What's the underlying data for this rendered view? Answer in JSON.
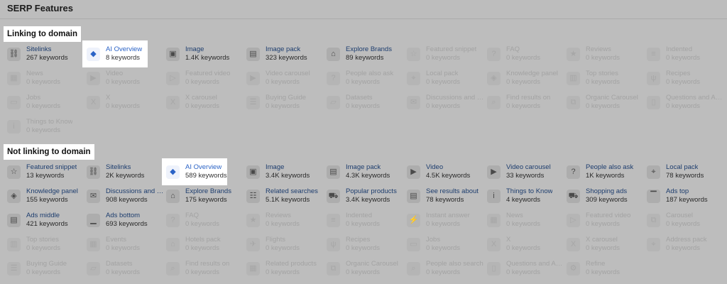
{
  "title": "SERP Features",
  "sections": {
    "linking": {
      "label": "Linking to domain",
      "rows": [
        [
          {
            "name": "Sitelinks",
            "count": "267 keywords",
            "icon": "link-icon",
            "state": "active"
          },
          {
            "name": "AI Overview",
            "count": "8 keywords",
            "icon": "ai-overview-icon",
            "state": "highlight"
          },
          {
            "name": "Image",
            "count": "1.4K keywords",
            "icon": "image-icon",
            "state": "active"
          },
          {
            "name": "Image pack",
            "count": "323 keywords",
            "icon": "image-pack-icon",
            "state": "active"
          },
          {
            "name": "Explore Brands",
            "count": "89 keywords",
            "icon": "tag-icon",
            "state": "active"
          },
          {
            "name": "Featured snippet",
            "count": "0 keywords",
            "icon": "featured-snippet-icon",
            "state": "dim"
          },
          {
            "name": "FAQ",
            "count": "0 keywords",
            "icon": "faq-icon",
            "state": "dim"
          },
          {
            "name": "Reviews",
            "count": "0 keywords",
            "icon": "star-icon",
            "state": "dim"
          },
          {
            "name": "Indented",
            "count": "0 keywords",
            "icon": "indented-icon",
            "state": "dim"
          }
        ],
        [
          {
            "name": "News",
            "count": "0 keywords",
            "icon": "news-icon",
            "state": "dim"
          },
          {
            "name": "Video",
            "count": "0 keywords",
            "icon": "video-icon",
            "state": "dim"
          },
          {
            "name": "Featured video",
            "count": "0 keywords",
            "icon": "featured-video-icon",
            "state": "dim"
          },
          {
            "name": "Video carousel",
            "count": "0 keywords",
            "icon": "video-carousel-icon",
            "state": "dim"
          },
          {
            "name": "People also ask",
            "count": "0 keywords",
            "icon": "people-also-ask-icon",
            "state": "dim"
          },
          {
            "name": "Local pack",
            "count": "0 keywords",
            "icon": "location-pin-icon",
            "state": "dim"
          },
          {
            "name": "Knowledge panel",
            "count": "0 keywords",
            "icon": "knowledge-panel-icon",
            "state": "dim"
          },
          {
            "name": "Top stories",
            "count": "0 keywords",
            "icon": "top-stories-icon",
            "state": "dim"
          },
          {
            "name": "Recipes",
            "count": "0 keywords",
            "icon": "recipes-icon",
            "state": "dim"
          }
        ],
        [
          {
            "name": "Jobs",
            "count": "0 keywords",
            "icon": "briefcase-icon",
            "state": "dim"
          },
          {
            "name": "X",
            "count": "0 keywords",
            "icon": "x-icon",
            "state": "dim"
          },
          {
            "name": "X carousel",
            "count": "0 keywords",
            "icon": "x-carousel-icon",
            "state": "dim"
          },
          {
            "name": "Buying Guide",
            "count": "0 keywords",
            "icon": "buying-guide-icon",
            "state": "dim"
          },
          {
            "name": "Datasets",
            "count": "0 keywords",
            "icon": "datasets-icon",
            "state": "dim"
          },
          {
            "name": "Discussions and …",
            "count": "0 keywords",
            "icon": "discussions-icon",
            "state": "dim"
          },
          {
            "name": "Find results on",
            "count": "0 keywords",
            "icon": "find-results-icon",
            "state": "dim"
          },
          {
            "name": "Organic Carousel",
            "count": "0 keywords",
            "icon": "organic-carousel-icon",
            "state": "dim"
          },
          {
            "name": "Questions and A…",
            "count": "0 keywords",
            "icon": "questions-answers-icon",
            "state": "dim"
          }
        ],
        [
          {
            "name": "Things to Know",
            "count": "0 keywords",
            "icon": "things-to-know-icon",
            "state": "dim"
          }
        ]
      ]
    },
    "notlinking": {
      "label": "Not linking to domain",
      "rows": [
        [
          {
            "name": "Featured snippet",
            "count": "13 keywords",
            "icon": "featured-snippet-icon",
            "state": "active"
          },
          {
            "name": "Sitelinks",
            "count": "2K keywords",
            "icon": "link-icon",
            "state": "active"
          },
          {
            "name": "AI Overview",
            "count": "589 keywords",
            "icon": "ai-overview-icon",
            "state": "highlight"
          },
          {
            "name": "Image",
            "count": "3.4K keywords",
            "icon": "image-icon",
            "state": "active"
          },
          {
            "name": "Image pack",
            "count": "4.3K keywords",
            "icon": "image-pack-icon",
            "state": "active"
          },
          {
            "name": "Video",
            "count": "4.5K keywords",
            "icon": "video-icon",
            "state": "active"
          },
          {
            "name": "Video carousel",
            "count": "33 keywords",
            "icon": "video-carousel-icon",
            "state": "active"
          },
          {
            "name": "People also ask",
            "count": "1K keywords",
            "icon": "people-also-ask-icon",
            "state": "active"
          },
          {
            "name": "Local pack",
            "count": "78 keywords",
            "icon": "location-pin-icon",
            "state": "active"
          }
        ],
        [
          {
            "name": "Knowledge panel",
            "count": "155 keywords",
            "icon": "knowledge-panel-icon",
            "state": "active"
          },
          {
            "name": "Discussions and …",
            "count": "908 keywords",
            "icon": "discussions-icon",
            "state": "active"
          },
          {
            "name": "Explore Brands",
            "count": "175 keywords",
            "icon": "tag-icon",
            "state": "active"
          },
          {
            "name": "Related searches",
            "count": "5.1K keywords",
            "icon": "related-searches-icon",
            "state": "active"
          },
          {
            "name": "Popular products",
            "count": "3.4K keywords",
            "icon": "shopping-cart-icon",
            "state": "active"
          },
          {
            "name": "See results about",
            "count": "78 keywords",
            "icon": "see-results-icon",
            "state": "active"
          },
          {
            "name": "Things to Know",
            "count": "4 keywords",
            "icon": "things-to-know-icon",
            "state": "active"
          },
          {
            "name": "Shopping ads",
            "count": "309 keywords",
            "icon": "shopping-ads-icon",
            "state": "active"
          },
          {
            "name": "Ads top",
            "count": "187 keywords",
            "icon": "ads-top-icon",
            "state": "active"
          }
        ],
        [
          {
            "name": "Ads middle",
            "count": "421 keywords",
            "icon": "ads-middle-icon",
            "state": "active"
          },
          {
            "name": "Ads bottom",
            "count": "693 keywords",
            "icon": "ads-bottom-icon",
            "state": "active"
          },
          {
            "name": "FAQ",
            "count": "0 keywords",
            "icon": "faq-icon",
            "state": "dim"
          },
          {
            "name": "Reviews",
            "count": "0 keywords",
            "icon": "star-icon",
            "state": "dim"
          },
          {
            "name": "Indented",
            "count": "0 keywords",
            "icon": "indented-icon",
            "state": "dim"
          },
          {
            "name": "Instant answer",
            "count": "0 keywords",
            "icon": "instant-answer-icon",
            "state": "dim"
          },
          {
            "name": "News",
            "count": "0 keywords",
            "icon": "news-icon",
            "state": "dim"
          },
          {
            "name": "Featured video",
            "count": "0 keywords",
            "icon": "featured-video-icon",
            "state": "dim"
          },
          {
            "name": "Carousel",
            "count": "0 keywords",
            "icon": "carousel-icon",
            "state": "dim"
          }
        ],
        [
          {
            "name": "Top stories",
            "count": "0 keywords",
            "icon": "top-stories-icon",
            "state": "dim"
          },
          {
            "name": "Events",
            "count": "0 keywords",
            "icon": "events-icon",
            "state": "dim"
          },
          {
            "name": "Hotels pack",
            "count": "0 keywords",
            "icon": "hotels-pack-icon",
            "state": "dim"
          },
          {
            "name": "Flights",
            "count": "0 keywords",
            "icon": "flights-icon",
            "state": "dim"
          },
          {
            "name": "Recipes",
            "count": "0 keywords",
            "icon": "recipes-icon",
            "state": "dim"
          },
          {
            "name": "Jobs",
            "count": "0 keywords",
            "icon": "briefcase-icon",
            "state": "dim"
          },
          {
            "name": "X",
            "count": "0 keywords",
            "icon": "x-icon",
            "state": "dim"
          },
          {
            "name": "X carousel",
            "count": "0 keywords",
            "icon": "x-carousel-icon",
            "state": "dim"
          },
          {
            "name": "Address pack",
            "count": "0 keywords",
            "icon": "address-pack-icon",
            "state": "dim"
          }
        ],
        [
          {
            "name": "Buying Guide",
            "count": "0 keywords",
            "icon": "buying-guide-icon",
            "state": "dim"
          },
          {
            "name": "Datasets",
            "count": "0 keywords",
            "icon": "datasets-icon",
            "state": "dim"
          },
          {
            "name": "Find results on",
            "count": "0 keywords",
            "icon": "find-results-icon",
            "state": "dim"
          },
          {
            "name": "Related products",
            "count": "0 keywords",
            "icon": "related-products-icon",
            "state": "dim"
          },
          {
            "name": "Organic Carousel",
            "count": "0 keywords",
            "icon": "organic-carousel-icon",
            "state": "dim"
          },
          {
            "name": "People also search",
            "count": "0 keywords",
            "icon": "people-also-search-icon",
            "state": "dim"
          },
          {
            "name": "Questions and A…",
            "count": "0 keywords",
            "icon": "questions-answers-icon",
            "state": "dim"
          },
          {
            "name": "Refine",
            "count": "0 keywords",
            "icon": "refine-icon",
            "state": "dim"
          }
        ]
      ]
    }
  },
  "colors": {
    "overlay_bg": "#bdbdbd",
    "link_text": "#1d3d6e",
    "highlight_link": "#2b63c6",
    "highlight_bg": "#ffffff"
  }
}
